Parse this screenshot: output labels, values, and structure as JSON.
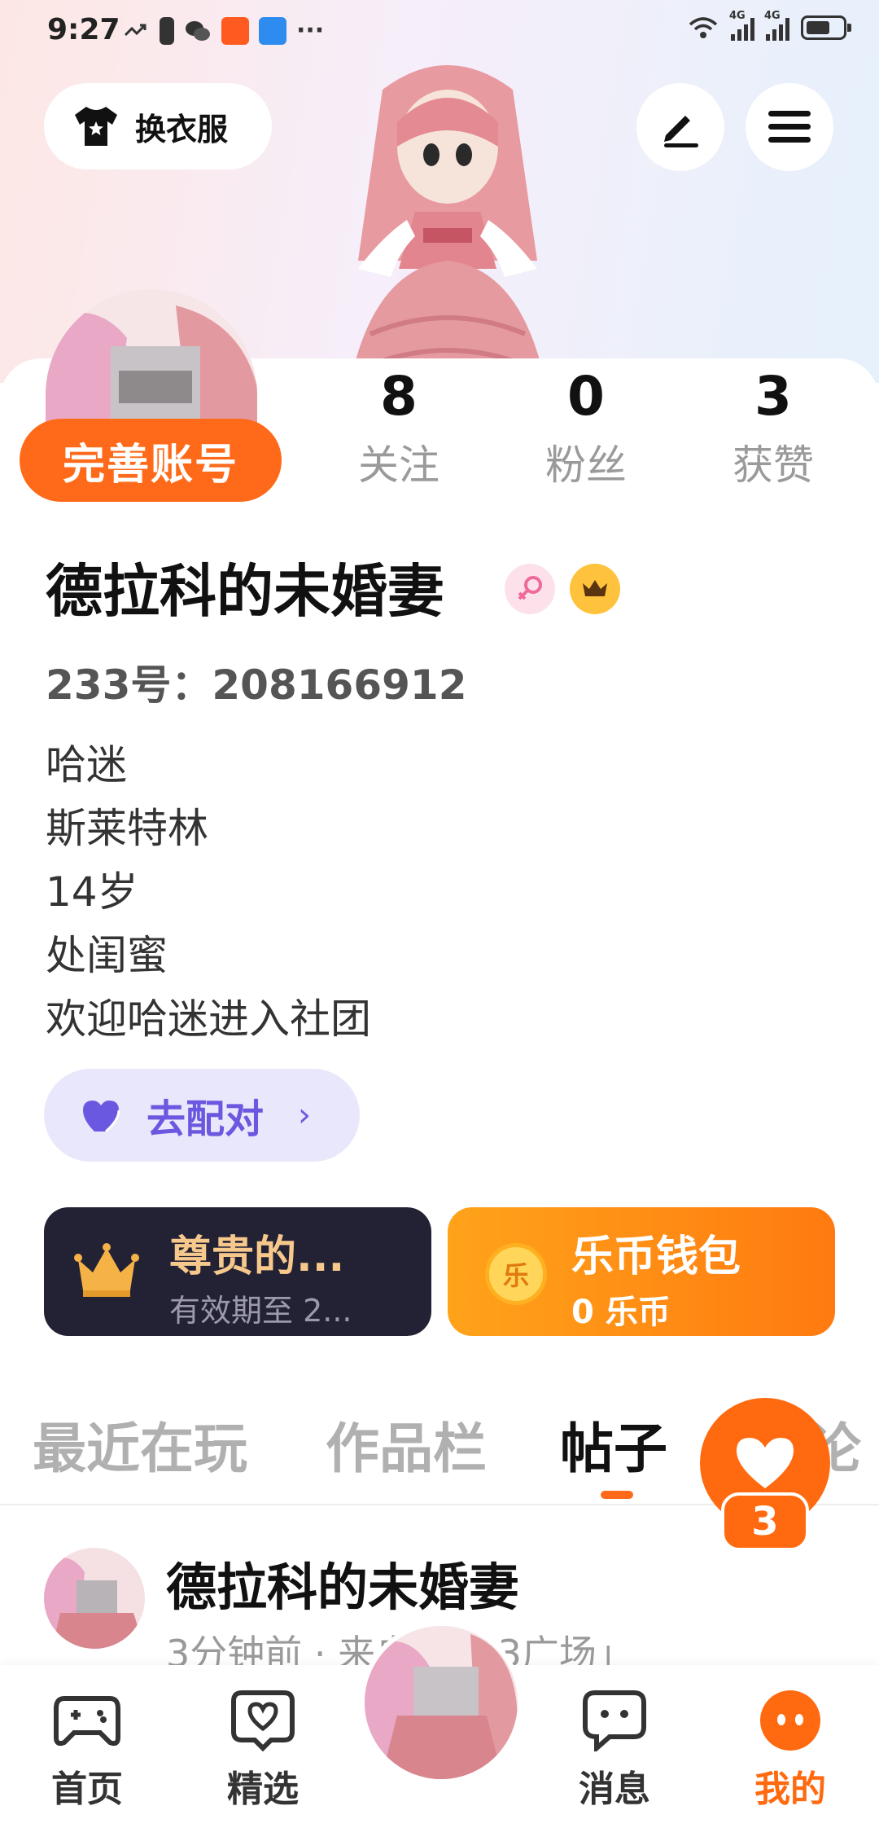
{
  "status_bar": {
    "time": "9:27",
    "more": "···"
  },
  "top": {
    "outfit_label": "换衣服"
  },
  "profile": {
    "complete_label": "完善账号",
    "stats": [
      {
        "value": "8",
        "label": "关注"
      },
      {
        "value": "0",
        "label": "粉丝"
      },
      {
        "value": "3",
        "label": "获赞"
      }
    ],
    "username": "德拉科的未婚妻",
    "id_text": "233号：208166912",
    "bio_lines": [
      "哈迷",
      "斯莱特林",
      "14岁",
      "处闺蜜",
      "欢迎哈迷进入社团"
    ],
    "match_label": "去配对",
    "match_chevron": "›"
  },
  "cards": {
    "vip_title": "尊贵的...",
    "vip_sub": "有效期至 2...",
    "wallet_title": "乐币钱包",
    "wallet_sub": "0 乐币",
    "coin_glyph": "乐"
  },
  "tabs": [
    {
      "label": "最近在玩",
      "active": false
    },
    {
      "label": "作品栏",
      "active": false
    },
    {
      "label": "帖子",
      "active": true
    },
    {
      "label": "评论",
      "active": false
    }
  ],
  "like_fab": {
    "count": "3"
  },
  "post": {
    "author": "德拉科的未婚妻",
    "meta": "3分钟前 · 来自「233广场」"
  },
  "bottom_nav": [
    {
      "label": "首页",
      "icon": "gamepad-icon"
    },
    {
      "label": "精选",
      "icon": "heart-chat-icon"
    },
    {
      "label": "消息",
      "icon": "message-icon"
    },
    {
      "label": "我的",
      "icon": "profile-face-icon",
      "active": true
    }
  ],
  "colors": {
    "accent": "#ff6a1a",
    "match_purple": "#6a58e0",
    "vip_dark": "#232235",
    "vip_gold": "#f7c88c"
  }
}
